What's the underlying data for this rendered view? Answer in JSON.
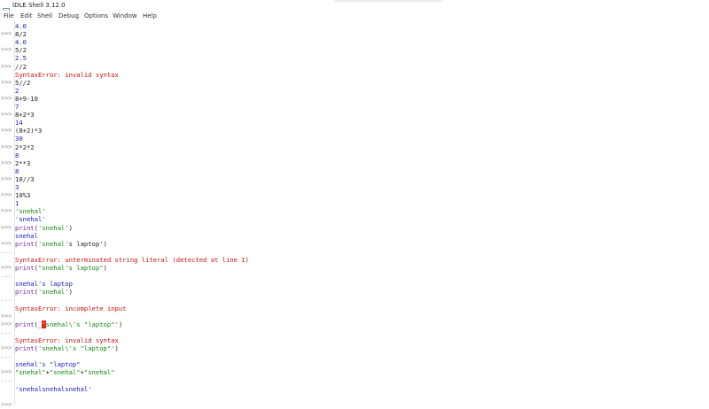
{
  "window": {
    "title": "IDLE Shell 3.12.0",
    "app_icon": "python-idle-icon"
  },
  "menubar": {
    "items": [
      "File",
      "Edit",
      "Shell",
      "Debug",
      "Options",
      "Window",
      "Help"
    ]
  },
  "colors": {
    "input": "#222222",
    "output": "#1a1ac8",
    "error": "#cc1111",
    "string": "#118811",
    "builtin": "#7722aa",
    "prompt": "#8a8a8a",
    "cursor": "#e0281e"
  },
  "shell_lines": [
    {
      "prompt": "",
      "kind": "output",
      "text": "4.0"
    },
    {
      "prompt": ">>>",
      "kind": "input",
      "text": "8/2"
    },
    {
      "prompt": "",
      "kind": "output",
      "text": "4.0"
    },
    {
      "prompt": ">>>",
      "kind": "input",
      "text": "5/2"
    },
    {
      "prompt": "",
      "kind": "output",
      "text": "2.5"
    },
    {
      "prompt": ">>>",
      "kind": "input",
      "text": "//2"
    },
    {
      "prompt": "",
      "kind": "error",
      "text": "SyntaxError: invalid syntax"
    },
    {
      "prompt": ">>>",
      "kind": "input",
      "text": "5//2"
    },
    {
      "prompt": "",
      "kind": "output",
      "text": "2"
    },
    {
      "prompt": ">>>",
      "kind": "input",
      "text": "8+9-10"
    },
    {
      "prompt": "",
      "kind": "output",
      "text": "7"
    },
    {
      "prompt": ">>>",
      "kind": "input",
      "text": "8+2*3"
    },
    {
      "prompt": "",
      "kind": "output",
      "text": "14"
    },
    {
      "prompt": ">>>",
      "kind": "input",
      "text": "(8+2)*3"
    },
    {
      "prompt": "",
      "kind": "output",
      "text": "30"
    },
    {
      "prompt": ">>>",
      "kind": "input",
      "text": "2*2*2"
    },
    {
      "prompt": "",
      "kind": "output",
      "text": "8"
    },
    {
      "prompt": ">>>",
      "kind": "input",
      "text": "2**3"
    },
    {
      "prompt": "",
      "kind": "output",
      "text": "8"
    },
    {
      "prompt": ">>>",
      "kind": "input",
      "text": "10//3"
    },
    {
      "prompt": "",
      "kind": "output",
      "text": "3"
    },
    {
      "prompt": ">>>",
      "kind": "input",
      "text": "10%3"
    },
    {
      "prompt": "",
      "kind": "output",
      "text": "1"
    },
    {
      "prompt": ">>>",
      "kind": "input",
      "segments": [
        {
          "t": "'snehal'",
          "c": "string"
        }
      ]
    },
    {
      "prompt": "",
      "kind": "output",
      "text": "'snehal'"
    },
    {
      "prompt": ">>>",
      "kind": "input",
      "segments": [
        {
          "t": "print",
          "c": "builtin"
        },
        {
          "t": "(",
          "c": "input"
        },
        {
          "t": "'snehal'",
          "c": "string"
        },
        {
          "t": ")",
          "c": "input"
        }
      ]
    },
    {
      "prompt": "",
      "kind": "output",
      "text": "snehal"
    },
    {
      "prompt": ">>>",
      "kind": "input",
      "segments": [
        {
          "t": "print",
          "c": "builtin"
        },
        {
          "t": "(",
          "c": "input"
        },
        {
          "t": "'snehal'",
          "c": "string"
        },
        {
          "t": "s laptop')",
          "c": "input"
        }
      ]
    },
    {
      "prompt": "...",
      "kind": "input",
      "text": ""
    },
    {
      "prompt": "",
      "kind": "error",
      "text": "SyntaxError: unterminated string literal (detected at line 1)"
    },
    {
      "prompt": ">>>",
      "kind": "input",
      "segments": [
        {
          "t": "print",
          "c": "builtin"
        },
        {
          "t": "(",
          "c": "input"
        },
        {
          "t": "\"snehal's laptop\"",
          "c": "string"
        },
        {
          "t": ")",
          "c": "input"
        }
      ]
    },
    {
      "prompt": "...",
      "kind": "input",
      "text": ""
    },
    {
      "prompt": "",
      "kind": "output",
      "text": "snehal's laptop"
    },
    {
      "prompt": "",
      "kind": "input",
      "segments": [
        {
          "t": "print",
          "c": "builtin"
        },
        {
          "t": "(",
          "c": "input"
        },
        {
          "t": "'snehal'",
          "c": "string"
        },
        {
          "t": ")",
          "c": "input"
        }
      ]
    },
    {
      "prompt": "...",
      "kind": "input",
      "text": ""
    },
    {
      "prompt": "",
      "kind": "error",
      "text": "SyntaxError: incomplete input"
    },
    {
      "prompt": ">>>",
      "kind": "input",
      "text": ""
    },
    {
      "prompt": ">>>",
      "kind": "input",
      "segments": [
        {
          "t": "print",
          "c": "builtin"
        },
        {
          "t": "(",
          "c": "input"
        },
        {
          "t": "_",
          "c": "input"
        },
        {
          "t": "'",
          "c": "cursor"
        },
        {
          "t": "snehal\\'s \"laptop\"'",
          "c": "string"
        },
        {
          "t": ")",
          "c": "input"
        }
      ]
    },
    {
      "prompt": "...",
      "kind": "input",
      "text": ""
    },
    {
      "prompt": "",
      "kind": "error",
      "text": "SyntaxError: invalid syntax"
    },
    {
      "prompt": ">>>",
      "kind": "input",
      "segments": [
        {
          "t": "print",
          "c": "builtin"
        },
        {
          "t": "(",
          "c": "input"
        },
        {
          "t": "'snehal\\'s \"laptop\"'",
          "c": "string"
        },
        {
          "t": ")",
          "c": "input"
        }
      ]
    },
    {
      "prompt": "...",
      "kind": "input",
      "text": ""
    },
    {
      "prompt": "",
      "kind": "output",
      "text": "snehal's \"laptop\""
    },
    {
      "prompt": ">>>",
      "kind": "input",
      "segments": [
        {
          "t": "\"snehal\"",
          "c": "string"
        },
        {
          "t": "+",
          "c": "input"
        },
        {
          "t": "\"snehal\"",
          "c": "string"
        },
        {
          "t": "+",
          "c": "input"
        },
        {
          "t": "\"snehal\"",
          "c": "string"
        }
      ]
    },
    {
      "prompt": "...",
      "kind": "input",
      "text": ""
    },
    {
      "prompt": "",
      "kind": "output",
      "text": "'snehalsnehalsnehal'"
    },
    {
      "prompt": "",
      "kind": "input",
      "text": ""
    },
    {
      "prompt": ">>>",
      "kind": "input",
      "text": ""
    }
  ]
}
